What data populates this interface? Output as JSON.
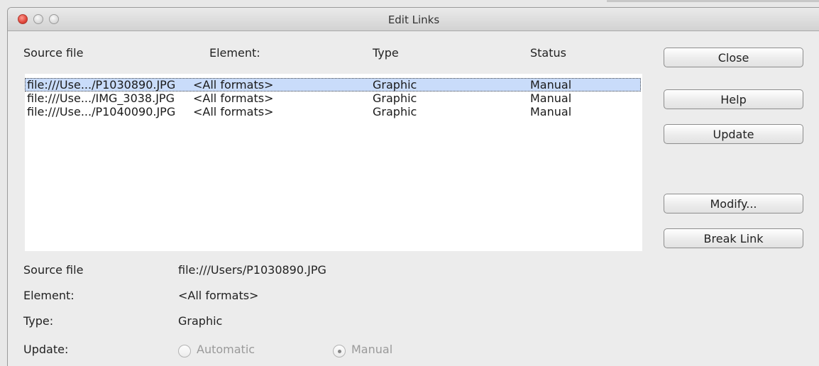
{
  "window": {
    "title": "Edit Links"
  },
  "columns": {
    "source": "Source file",
    "element": "Element:",
    "type": "Type",
    "status": "Status"
  },
  "links": [
    {
      "source": "file:///Use.../P1030890.JPG",
      "element": "<All formats>",
      "type": "Graphic",
      "status": "Manual",
      "selected": true
    },
    {
      "source": "file:///Use.../IMG_3038.JPG",
      "element": "<All formats>",
      "type": "Graphic",
      "status": "Manual",
      "selected": false
    },
    {
      "source": "file:///Use.../P1040090.JPG",
      "element": "<All formats>",
      "type": "Graphic",
      "status": "Manual",
      "selected": false
    }
  ],
  "buttons": {
    "close": "Close",
    "help": "Help",
    "update": "Update",
    "modify": "Modify...",
    "break_link": "Break Link"
  },
  "details": {
    "source_label": "Source file",
    "source_value": "file:///Users/P1030890.JPG",
    "element_label": "Element:",
    "element_value": "<All formats>",
    "type_label": "Type:",
    "type_value": "Graphic",
    "update_label": "Update:",
    "update_options": {
      "automatic": "Automatic",
      "manual": "Manual",
      "selected": "manual",
      "enabled": false
    }
  },
  "colors": {
    "selection": "#c9dcfa",
    "window_bg": "#ececec",
    "close_button": "#e0463b"
  }
}
